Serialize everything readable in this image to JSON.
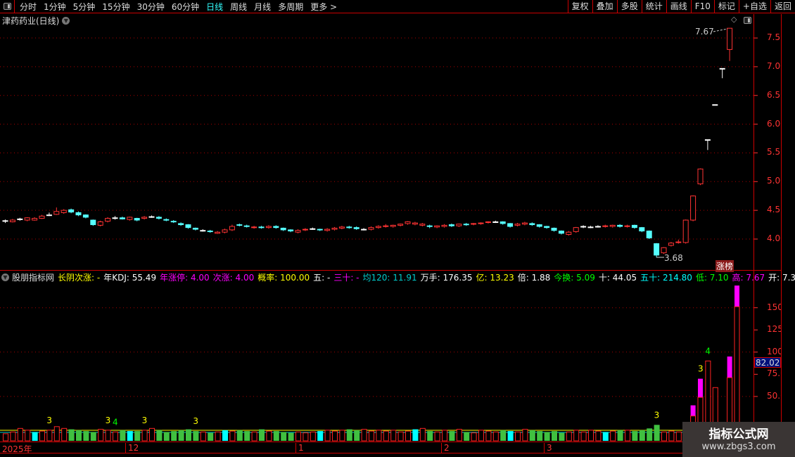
{
  "toolbar": {
    "periods": [
      "分时",
      "1分钟",
      "5分钟",
      "15分钟",
      "30分钟",
      "60分钟",
      "日线",
      "周线",
      "月线",
      "多周期",
      "更多 >"
    ],
    "active": "日线",
    "right_buttons": [
      "复权",
      "叠加",
      "多股",
      "统计",
      "画线",
      "F10",
      "标记",
      "+自选",
      "返回"
    ]
  },
  "chart": {
    "title": "津药药业(日线)",
    "high_label": "7.67",
    "low_label": "3.68",
    "limit_badge": "涨榜",
    "price_axis": [
      "7.50",
      "7.00",
      "6.50",
      "6.00",
      "5.50",
      "5.00",
      "4.50",
      "4.00"
    ]
  },
  "indicator": {
    "items": [
      {
        "text": "股朋指标网",
        "color": "#dddddd"
      },
      {
        "text": "长阴次涨: -",
        "color": "#ffff00"
      },
      {
        "text": "年KDJ: 55.49",
        "color": "#ffffff"
      },
      {
        "text": "年涨停: 4.00",
        "color": "#ff00ff"
      },
      {
        "text": "次涨: 4.00",
        "color": "#ff00ff"
      },
      {
        "text": "概率: 100.00",
        "color": "#ffff00"
      },
      {
        "text": "五: -",
        "color": "#ffffff"
      },
      {
        "text": "三十: -",
        "color": "#ff00ff"
      },
      {
        "text": "均120: 11.91",
        "color": "#00cccc"
      },
      {
        "text": "万手: 176.35",
        "color": "#ffffff"
      },
      {
        "text": "亿: 13.23",
        "color": "#ffff00"
      },
      {
        "text": "倍: 1.88",
        "color": "#ffffff"
      },
      {
        "text": "今换: 5.09",
        "color": "#00ff00"
      },
      {
        "text": "十: 44.05",
        "color": "#ffffff"
      },
      {
        "text": "五十: 214.80",
        "color": "#00ffff"
      },
      {
        "text": "低: 7.10",
        "color": "#00ff00"
      },
      {
        "text": "高: 7.67",
        "color": "#ff00ff"
      },
      {
        "text": "开: 7.30",
        "color": "#ffffff"
      }
    ],
    "axis": [
      "150.0",
      "125.0",
      "100.0",
      "75.00",
      "50.00"
    ],
    "current_value": "82.02"
  },
  "time_axis": [
    "2025年",
    "12",
    "1",
    "2",
    "3"
  ],
  "watermark": {
    "line1": "指标公式网",
    "line2": "www.zbgs3.com"
  },
  "colors": {
    "up": "#ff3333",
    "down": "#55ffff",
    "flat": "#ffffff",
    "grid": "#aa0000",
    "axis": "#ff3333"
  },
  "chart_data": {
    "type": "candlestick",
    "ylim": [
      3.6,
      7.8
    ],
    "close": [
      4.32,
      4.33,
      4.35,
      4.37,
      4.36,
      4.4,
      4.42,
      4.48,
      4.5,
      4.47,
      4.42,
      4.38,
      4.25,
      4.3,
      4.36,
      4.37,
      4.35,
      4.38,
      4.33,
      4.38,
      4.39,
      4.36,
      4.33,
      4.3,
      4.25,
      4.2,
      4.17,
      4.15,
      4.13,
      4.12,
      4.16,
      4.22,
      4.24,
      4.22,
      4.21,
      4.2,
      4.22,
      4.2,
      4.16,
      4.14,
      4.15,
      4.17,
      4.18,
      4.16,
      4.17,
      4.19,
      4.21,
      4.2,
      4.18,
      4.17,
      4.2,
      4.22,
      4.23,
      4.24,
      4.26,
      4.3,
      4.28,
      4.26,
      4.22,
      4.23,
      4.24,
      4.23,
      4.26,
      4.25,
      4.27,
      4.28,
      4.3,
      4.3,
      4.27,
      4.22,
      4.26,
      4.28,
      4.25,
      4.22,
      4.2,
      4.15,
      4.1,
      4.12,
      4.2,
      4.22,
      4.21,
      4.22,
      4.23,
      4.24,
      4.22,
      4.23,
      4.2,
      4.14,
      4.02,
      3.72,
      3.85,
      3.93,
      3.95,
      4.33,
      4.75,
      5.22,
      5.73,
      6.34,
      6.97,
      7.67
    ],
    "open": [
      4.32,
      4.3,
      4.35,
      4.33,
      4.33,
      4.36,
      4.42,
      4.43,
      4.46,
      4.51,
      4.46,
      4.42,
      4.33,
      4.24,
      4.31,
      4.37,
      4.37,
      4.34,
      4.36,
      4.36,
      4.39,
      4.38,
      4.34,
      4.31,
      4.27,
      4.25,
      4.19,
      4.15,
      4.14,
      4.1,
      4.12,
      4.16,
      4.25,
      4.23,
      4.2,
      4.21,
      4.2,
      4.22,
      4.19,
      4.16,
      4.12,
      4.16,
      4.18,
      4.17,
      4.15,
      4.17,
      4.19,
      4.21,
      4.2,
      4.17,
      4.17,
      4.2,
      4.22,
      4.22,
      4.24,
      4.27,
      4.26,
      4.24,
      4.23,
      4.21,
      4.22,
      4.25,
      4.23,
      4.26,
      4.26,
      4.27,
      4.29,
      4.3,
      4.3,
      4.27,
      4.24,
      4.26,
      4.27,
      4.25,
      4.22,
      4.19,
      4.14,
      4.08,
      4.13,
      4.22,
      4.21,
      4.22,
      4.22,
      4.22,
      4.24,
      4.22,
      4.24,
      4.2,
      4.14,
      3.92,
      3.76,
      3.89,
      3.94,
      3.94,
      4.33,
      4.96,
      5.73,
      6.34,
      6.97,
      7.3
    ],
    "high": [
      4.34,
      4.35,
      4.37,
      4.38,
      4.38,
      4.42,
      4.46,
      4.55,
      4.52,
      4.53,
      4.48,
      4.43,
      4.34,
      4.32,
      4.38,
      4.4,
      4.39,
      4.39,
      4.37,
      4.4,
      4.41,
      4.4,
      4.36,
      4.33,
      4.29,
      4.26,
      4.2,
      4.17,
      4.16,
      4.14,
      4.18,
      4.25,
      4.27,
      4.25,
      4.23,
      4.23,
      4.24,
      4.24,
      4.2,
      4.17,
      4.17,
      4.19,
      4.2,
      4.18,
      4.19,
      4.21,
      4.23,
      4.23,
      4.22,
      4.19,
      4.22,
      4.24,
      4.26,
      4.25,
      4.27,
      4.31,
      4.3,
      4.28,
      4.25,
      4.24,
      4.26,
      4.27,
      4.27,
      4.28,
      4.28,
      4.29,
      4.31,
      4.32,
      4.31,
      4.28,
      4.28,
      4.3,
      4.29,
      4.26,
      4.23,
      4.2,
      4.15,
      4.14,
      4.21,
      4.24,
      4.23,
      4.24,
      4.25,
      4.25,
      4.26,
      4.25,
      4.25,
      4.21,
      4.15,
      3.93,
      3.86,
      3.95,
      3.99,
      4.34,
      4.76,
      5.23,
      5.73,
      6.34,
      6.97,
      7.67
    ],
    "low": [
      4.28,
      4.29,
      4.32,
      4.31,
      4.32,
      4.35,
      4.4,
      4.42,
      4.44,
      4.45,
      4.4,
      4.36,
      4.23,
      4.22,
      4.29,
      4.34,
      4.34,
      4.32,
      4.31,
      4.34,
      4.37,
      4.34,
      4.31,
      4.28,
      4.23,
      4.18,
      4.15,
      4.13,
      4.11,
      4.09,
      4.1,
      4.14,
      4.22,
      4.2,
      4.18,
      4.18,
      4.18,
      4.18,
      4.14,
      4.12,
      4.1,
      4.14,
      4.16,
      4.14,
      4.13,
      4.15,
      4.17,
      4.18,
      4.16,
      4.15,
      4.15,
      4.18,
      4.2,
      4.2,
      4.22,
      4.25,
      4.24,
      4.22,
      4.19,
      4.19,
      4.2,
      4.21,
      4.21,
      4.23,
      4.24,
      4.25,
      4.27,
      4.28,
      4.25,
      4.2,
      4.22,
      4.24,
      4.23,
      4.2,
      4.18,
      4.13,
      4.08,
      4.06,
      4.11,
      4.19,
      4.19,
      4.2,
      4.2,
      4.2,
      4.2,
      4.2,
      4.18,
      4.12,
      4.0,
      3.68,
      3.74,
      3.87,
      3.92,
      3.92,
      4.31,
      4.94,
      5.55,
      6.34,
      6.8,
      7.1
    ],
    "volume_axis": [
      50,
      75,
      100,
      125,
      150
    ],
    "volume": [
      8,
      10,
      14,
      12,
      10,
      11,
      12,
      16,
      14,
      13,
      12,
      11,
      10,
      13,
      12,
      10,
      12,
      11,
      11,
      12,
      14,
      12,
      10,
      11,
      12,
      13,
      11,
      10,
      9,
      10,
      12,
      11,
      12,
      11,
      10,
      13,
      11,
      11,
      10,
      9,
      10,
      9,
      10,
      11,
      12,
      11,
      12,
      13,
      12,
      13,
      11,
      12,
      11,
      12,
      10,
      11,
      13,
      14,
      11,
      10,
      12,
      11,
      13,
      10,
      9,
      12,
      11,
      10,
      12,
      11,
      10,
      13,
      12,
      11,
      10,
      11,
      9,
      10,
      12,
      10,
      12,
      11,
      10,
      11,
      12,
      12,
      11,
      12,
      14,
      18,
      10,
      11,
      10,
      12,
      40,
      70,
      90,
      60,
      20,
      95,
      175
    ],
    "volume_labels": [
      {
        "i": 6,
        "text": "3",
        "color": "#ffff00"
      },
      {
        "i": 14,
        "text": "3",
        "color": "#ffff00"
      },
      {
        "i": 15,
        "text": "4",
        "color": "#00ff00"
      },
      {
        "i": 19,
        "text": "3",
        "color": "#ffff00"
      },
      {
        "i": 26,
        "text": "3",
        "color": "#ffff00"
      },
      {
        "i": 89,
        "text": "3",
        "color": "#ffff00"
      },
      {
        "i": 95,
        "text": "3",
        "color": "#ffff00"
      },
      {
        "i": 96,
        "text": "4",
        "color": "#00ff00"
      }
    ]
  }
}
